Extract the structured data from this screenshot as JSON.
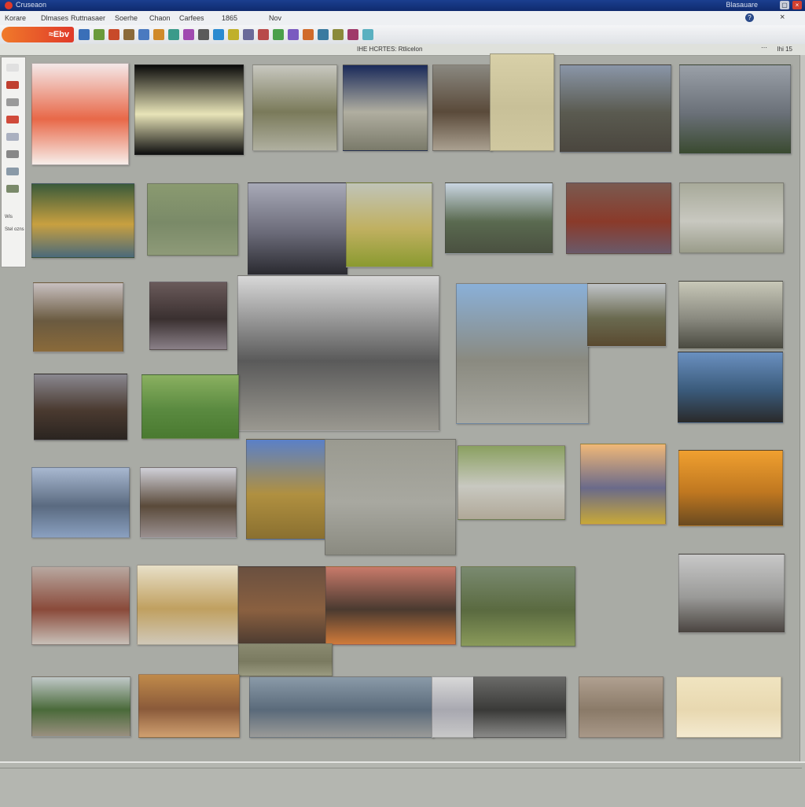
{
  "window": {
    "title": "Cruseaon",
    "right_label": "Blasauare",
    "minimize": "▢",
    "close": "×"
  },
  "menu": [
    "Korare",
    "Dlmases",
    "Ruttnasaer",
    "Soerhe",
    "Chaon",
    "Carfees",
    "1865",
    "Nov"
  ],
  "menu_right": {
    "help": "?",
    "close": "×"
  },
  "toolbar": {
    "logo_text": "≈Ebv",
    "tool_colors": [
      "#3a6fb8",
      "#6a9a3a",
      "#c84a2a",
      "#8a6a3a",
      "#4a7ac0",
      "#d08a2a",
      "#3a9a8a",
      "#a04ab0",
      "#5a5a5a",
      "#2a8ad0",
      "#c0b02a",
      "#6a6a9a",
      "#b84a4a",
      "#4aa04a",
      "#7a5ac0",
      "#d06a2a",
      "#3a7aa0",
      "#8a8a3a",
      "#a03a6a",
      "#5ab0c0"
    ]
  },
  "pathbar": {
    "path": "IHE HCRTES: Rtlicelon",
    "count": "Ihi 15",
    "dots": "⋯"
  },
  "sidebar": {
    "labels": [
      "Wis",
      "Stel ozns"
    ],
    "icon_colors": [
      "#e0e0e0",
      "#c04030",
      "#9a9a9a",
      "#d04a3a",
      "#aab0c0",
      "#888",
      "#8a9aa8",
      "#7a8a6a"
    ]
  },
  "thumbnails": [
    {
      "name": "thumb-red-flower",
      "colors": [
        "#f4e8e8",
        "#e86848",
        "#f7eeea"
      ]
    },
    {
      "name": "thumb-white-chrysanthemum",
      "colors": [
        "#0a0a0a",
        "#e8e4b8",
        "#101010"
      ]
    },
    {
      "name": "thumb-mossy-ruin",
      "colors": [
        "#c8c8c0",
        "#7a7a5a",
        "#b0b0a0"
      ]
    },
    {
      "name": "thumb-dark-doorway",
      "colors": [
        "#1a2a5a",
        "#b0aea0",
        "#7a7a6a"
      ]
    },
    {
      "name": "thumb-stone-hut",
      "colors": [
        "#8a8880",
        "#5a4a3a",
        "#aaa090"
      ]
    },
    {
      "name": "thumb-beige-paper",
      "colors": [
        "#d8d0a8",
        "#c8c098",
        "#d0c8a0"
      ]
    },
    {
      "name": "thumb-misty-moor",
      "colors": [
        "#8a96a8",
        "#5a5a50",
        "#4a463e"
      ]
    },
    {
      "name": "thumb-mountain-lake",
      "colors": [
        "#9aa0a8",
        "#6a7078",
        "#3a4a30"
      ]
    },
    {
      "name": "thumb-flower-mosaic",
      "colors": [
        "#3a5a3a",
        "#c8a040",
        "#4a6a7a"
      ]
    },
    {
      "name": "thumb-green-blur",
      "colors": [
        "#8a9a70",
        "#7a8a68",
        "#8e9a78"
      ]
    },
    {
      "name": "thumb-foggy-shore",
      "colors": [
        "#a8aab8",
        "#6a6a78",
        "#2a2a30"
      ]
    },
    {
      "name": "thumb-golden-grass",
      "colors": [
        "#c0c4b8",
        "#c0b060",
        "#8a9a30"
      ]
    },
    {
      "name": "thumb-river-moor",
      "colors": [
        "#cad6e2",
        "#5a6a50",
        "#4a5040"
      ]
    },
    {
      "name": "thumb-rust-texture",
      "colors": [
        "#7a5a50",
        "#8a3a2a",
        "#6a5a6a"
      ]
    },
    {
      "name": "thumb-gray-lichen",
      "colors": [
        "#a8aa9a",
        "#c8c8c0",
        "#9a9c8a"
      ]
    },
    {
      "name": "thumb-hills-road",
      "colors": [
        "#c8c0c0",
        "#6a5a40",
        "#8a6a3a"
      ]
    },
    {
      "name": "thumb-dark-interior",
      "colors": [
        "#6a5a5a",
        "#3a3030",
        "#8a8088"
      ]
    },
    {
      "name": "thumb-castle-loch",
      "colors": [
        "#d8d8d8",
        "#5a5a5a",
        "#9a9890"
      ]
    },
    {
      "name": "thumb-blue-sky-shore",
      "colors": [
        "#8ab0d8",
        "#8a8a80",
        "#a8a8a0"
      ]
    },
    {
      "name": "thumb-ridge-field",
      "colors": [
        "#c0c4c8",
        "#6a6a50",
        "#5a4a30"
      ]
    },
    {
      "name": "thumb-shell-light",
      "colors": [
        "#c8c8b8",
        "#8a8a80",
        "#4a4a40"
      ]
    },
    {
      "name": "thumb-tree-silhouette",
      "colors": [
        "#8a8890",
        "#4a3a30",
        "#2a2420"
      ]
    },
    {
      "name": "thumb-green-field",
      "colors": [
        "#8ab060",
        "#5a8a40",
        "#4a7a30"
      ]
    },
    {
      "name": "thumb-blue-coast",
      "colors": [
        "#6a90c0",
        "#3a5a7a",
        "#2a2a2a"
      ]
    },
    {
      "name": "thumb-icy-sea",
      "colors": [
        "#a8b8d0",
        "#5a6a80",
        "#8aa0c0"
      ]
    },
    {
      "name": "thumb-rocky-beach",
      "colors": [
        "#d0d0d8",
        "#5a4a3a",
        "#9a9090"
      ]
    },
    {
      "name": "thumb-golden-hill",
      "colors": [
        "#5a80c8",
        "#b09040",
        "#8a7030"
      ]
    },
    {
      "name": "thumb-gray-sand",
      "colors": [
        "#9a9a90",
        "#a8a8a0",
        "#8a8a80"
      ]
    },
    {
      "name": "thumb-pebble-path",
      "colors": [
        "#8aa060",
        "#c8c8c0",
        "#b0a898"
      ]
    },
    {
      "name": "thumb-sunset-lake",
      "colors": [
        "#f0b878",
        "#6a6a8a",
        "#c8a838"
      ]
    },
    {
      "name": "thumb-orange-sunset",
      "colors": [
        "#f0a030",
        "#c07820",
        "#6a4a20"
      ]
    },
    {
      "name": "thumb-cloudy-shore",
      "colors": [
        "#c8c8c8",
        "#9a9a98",
        "#4a4440"
      ]
    },
    {
      "name": "thumb-autumn-tree",
      "colors": [
        "#b8a8a0",
        "#8a4a3a",
        "#c8c0b8"
      ]
    },
    {
      "name": "thumb-hazy-glow",
      "colors": [
        "#e8e0c8",
        "#c0a060",
        "#d0c8b8"
      ]
    },
    {
      "name": "thumb-brown-rocks",
      "colors": [
        "#6a5040",
        "#8a6040",
        "#4a3a30"
      ]
    },
    {
      "name": "thumb-canyon-sunset",
      "colors": [
        "#c87a6a",
        "#4a3a30",
        "#d07a3a"
      ]
    },
    {
      "name": "thumb-green-mound",
      "colors": [
        "#7a8a70",
        "#5a6a40",
        "#8a9a5a"
      ]
    },
    {
      "name": "thumb-mossy-rock",
      "colors": [
        "#8a8a70",
        "#7a7a60",
        "#9a9a80"
      ]
    },
    {
      "name": "thumb-bush-road",
      "colors": [
        "#c0c8c8",
        "#4a6a3a",
        "#9a9080"
      ]
    },
    {
      "name": "thumb-wooden-hut",
      "colors": [
        "#c08a4a",
        "#8a5a3a",
        "#d0a070"
      ]
    },
    {
      "name": "thumb-grey-bay",
      "colors": [
        "#8a9aa8",
        "#5a6a7a",
        "#9a9a98"
      ]
    },
    {
      "name": "thumb-pale-sea",
      "colors": [
        "#d8d8d8",
        "#a8a8b0",
        "#c8c8c8"
      ]
    },
    {
      "name": "thumb-dark-rocks",
      "colors": [
        "#6a6a68",
        "#3a3a38",
        "#8a8a88"
      ]
    },
    {
      "name": "thumb-twig-sand",
      "colors": [
        "#b0a090",
        "#8a7a68",
        "#a89888"
      ]
    },
    {
      "name": "thumb-cream-paper",
      "colors": [
        "#f0e4c0",
        "#e8d8b0",
        "#f4ead0"
      ]
    }
  ]
}
